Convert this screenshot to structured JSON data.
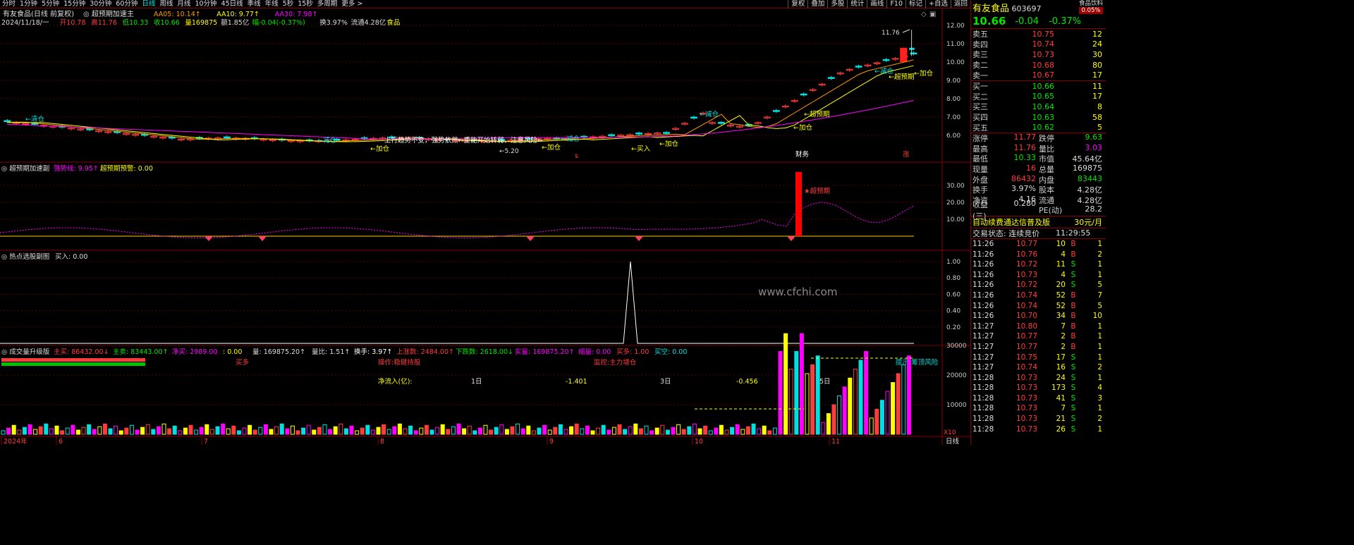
{
  "toolbar": {
    "tabs": [
      "分时",
      "1分钟",
      "5分钟",
      "15分钟",
      "30分钟",
      "60分钟",
      "日线",
      "周线",
      "月线",
      "10分钟",
      "45日线",
      "季线",
      "年线",
      "5秒",
      "15秒",
      "多周期",
      "更多 >"
    ],
    "selected": "日线",
    "right": [
      "复权",
      "叠加",
      "多股",
      "统计",
      "画线",
      "F10",
      "标记",
      "+自选",
      "返回"
    ]
  },
  "main": {
    "title": "有友食品(日线 前复权)",
    "indicator": "超预期加速主",
    "ma": [
      {
        "label": "AA05: 10.14↑",
        "color": "#ff9900"
      },
      {
        "label": "AA10: 9.77↑",
        "color": "#ffff00"
      },
      {
        "label": "AA30: 7.98↑",
        "color": "#ff00ff"
      }
    ],
    "info": [
      {
        "t": "2024/11/18/一",
        "c": "#dddddd"
      },
      {
        "t": "开10.78",
        "c": "#ff3c3c"
      },
      {
        "t": "高11.76",
        "c": "#ff3c3c"
      },
      {
        "t": "低10.33",
        "c": "#00e600"
      },
      {
        "t": "收10.66",
        "c": "#00e600"
      },
      {
        "t": "量169875",
        "c": "#ffff00"
      },
      {
        "t": "额1.85亿",
        "c": "#dddddd"
      },
      {
        "t": "幅-0.04(-0.37%)",
        "c": "#00e600"
      },
      {
        "t": "换3.97%",
        "c": "#dddddd"
      },
      {
        "t": "流通4.28亿",
        "c": "#dddddd"
      },
      {
        "t": "食品",
        "c": "#ffff00"
      }
    ],
    "yticks": [
      "12.00",
      "11.00",
      "10.00",
      "9.00",
      "8.00",
      "7.00",
      "6.00"
    ],
    "high_label": "11.76",
    "low_label": "←5.20",
    "annotations": [
      {
        "t": "←清仓",
        "c": "#00e0e0"
      },
      {
        "t": "←减仓",
        "c": "#00e0e0"
      },
      {
        "t": "←加仓",
        "c": "#ffff00"
      },
      {
        "t": "上行趋势不变，强势依然←重能开始转弱，注意风险←",
        "c": "#ffffff"
      },
      {
        "t": "←加仓",
        "c": "#ffff00"
      },
      {
        "t": "←减仓",
        "c": "#00e0e0"
      },
      {
        "t": "←买入",
        "c": "#ffff00"
      },
      {
        "t": "←加仓",
        "c": "#ffff00"
      },
      {
        "t": "←减仓",
        "c": "#00e0e0"
      },
      {
        "t": "←超预期",
        "c": "#ffff00"
      },
      {
        "t": "←加仓",
        "c": "#ffff00"
      },
      {
        "t": "←减仓",
        "c": "#00e0e0"
      },
      {
        "t": "←超预期",
        "c": "#ffff00"
      },
      {
        "t": "←加仓",
        "c": "#ffff00"
      },
      {
        "t": "财务",
        "c": "#ffffff"
      },
      {
        "t": "涨",
        "c": "#ff3c3c"
      },
      {
        "t": "s",
        "c": "#ff3c3c"
      }
    ]
  },
  "sub1": {
    "title": "超预期加速副",
    "lines": [
      {
        "label": "强势线: 9.95↑",
        "color": "#ff00ff"
      },
      {
        "label": "超预期预警: 0.00",
        "color": "#ffff00"
      }
    ],
    "yticks": [
      "30.00",
      "20.00",
      "10.00"
    ],
    "annotation": "★超预期"
  },
  "sub2": {
    "title": "热点选股副图",
    "value": "买入: 0.00",
    "yticks": [
      "1.00",
      "0.80",
      "0.60",
      "0.40",
      "0.20"
    ],
    "watermark": "www.cfchi.com"
  },
  "sub3": {
    "title": "成交量升级版",
    "items": [
      {
        "t": "主买: 86432.00↓",
        "c": "#ff3c3c"
      },
      {
        "t": "主卖: 83443.00↑",
        "c": "#00e600"
      },
      {
        "t": "净买: 2989.00",
        "c": "#ff00ff"
      },
      {
        "t": ": 0.00",
        "c": "#ffff00"
      },
      {
        "t": "量: 169875.20↑",
        "c": "#dddddd"
      },
      {
        "t": "量比: 1.51↑",
        "c": "#dddddd"
      },
      {
        "t": "换手: 3.97↑",
        "c": "#ffffff"
      },
      {
        "t": "上涨数: 2484.00↑",
        "c": "#ff3c3c"
      },
      {
        "t": "下跌数: 2618.00↓",
        "c": "#00e600"
      },
      {
        "t": "实量: 169875.20↑",
        "c": "#ff00ff"
      },
      {
        "t": "缩量: 0.00",
        "c": "#ff00ff"
      },
      {
        "t": "买多: 1.00",
        "c": "#ff3c3c"
      },
      {
        "t": "买空: 0.00",
        "c": "#00e0e0"
      }
    ],
    "labels": {
      "buy": "买多",
      "op": "操作:稳健持股",
      "mon": "监控:主力增仓",
      "tip": "提示:筹顶风险",
      "netflow": "净流入(亿):",
      "d1": "1日",
      "v1": "-1.401",
      "d3": "3日",
      "v3": "-0.456",
      "d5": "5日"
    },
    "yticks": [
      "30000",
      "20000",
      "10000"
    ],
    "scale": "X10"
  },
  "xaxis": {
    "labels": [
      "2024年",
      "6",
      "7",
      "8",
      "9",
      "10",
      "11"
    ],
    "period": "日线"
  },
  "side": {
    "name": "有友食品",
    "code": "603697",
    "badge": "食品饮料",
    "badge_pct": "0.05%",
    "price": "10.66",
    "change": "-0.04",
    "pct": "-0.37%",
    "asks": [
      {
        "l": "卖五",
        "p": "10.75",
        "v": "12"
      },
      {
        "l": "卖四",
        "p": "10.74",
        "v": "24"
      },
      {
        "l": "卖三",
        "p": "10.73",
        "v": "30"
      },
      {
        "l": "卖二",
        "p": "10.68",
        "v": "80"
      },
      {
        "l": "卖一",
        "p": "10.67",
        "v": "17"
      }
    ],
    "bids": [
      {
        "l": "买一",
        "p": "10.66",
        "v": "11"
      },
      {
        "l": "买二",
        "p": "10.65",
        "v": "17"
      },
      {
        "l": "买三",
        "p": "10.64",
        "v": "8"
      },
      {
        "l": "买四",
        "p": "10.63",
        "v": "58"
      },
      {
        "l": "买五",
        "p": "10.62",
        "v": "5"
      }
    ],
    "quote": [
      [
        {
          "l": "涨停",
          "v": "11.77",
          "c": "#ff3c3c"
        },
        {
          "l": "跌停",
          "v": "9.63",
          "c": "#00e600"
        }
      ],
      [
        {
          "l": "最高",
          "v": "11.76",
          "c": "#ff3c3c"
        },
        {
          "l": "量比",
          "v": "3.03",
          "c": "#ff00ff"
        }
      ],
      [
        {
          "l": "最低",
          "v": "10.33",
          "c": "#00e600"
        },
        {
          "l": "市值",
          "v": "45.64亿",
          "c": "#dddddd"
        }
      ],
      [
        {
          "l": "现量",
          "v": "16",
          "c": "#ff3c3c"
        },
        {
          "l": "总量",
          "v": "169875",
          "c": "#dddddd"
        }
      ],
      [
        {
          "l": "外盘",
          "v": "86432",
          "c": "#ff3c3c"
        },
        {
          "l": "内盘",
          "v": "83443",
          "c": "#00e600"
        }
      ],
      [
        {
          "l": "换手",
          "v": "3.97%",
          "c": "#dddddd"
        },
        {
          "l": "股本",
          "v": "4.28亿",
          "c": "#dddddd"
        }
      ],
      [
        {
          "l": "净资",
          "v": "4.16",
          "c": "#dddddd"
        },
        {
          "l": "流通",
          "v": "4.28亿",
          "c": "#dddddd"
        }
      ],
      [
        {
          "l": "收益(三)",
          "v": "0.280",
          "c": "#dddddd"
        },
        {
          "l": "PE(动)",
          "v": "28.2",
          "c": "#dddddd"
        }
      ]
    ],
    "promo": "自动续费通达信普及版",
    "promo_price": "30元/月",
    "status_label": "交易状态: 连续竞价",
    "status_time": "11:29:55",
    "ticks": [
      [
        "11:26",
        "10.77",
        "10",
        "B",
        "1"
      ],
      [
        "11:26",
        "10.76",
        "4",
        "B",
        "2"
      ],
      [
        "11:26",
        "10.72",
        "11",
        "S",
        "1"
      ],
      [
        "11:26",
        "10.73",
        "4",
        "S",
        "1"
      ],
      [
        "11:26",
        "10.72",
        "20",
        "S",
        "5"
      ],
      [
        "11:26",
        "10.74",
        "52",
        "B",
        "7"
      ],
      [
        "11:26",
        "10.74",
        "52",
        "B",
        "5"
      ],
      [
        "11:26",
        "10.70",
        "34",
        "B",
        "10"
      ],
      [
        "11:27",
        "10.80",
        "7",
        "B",
        "1"
      ],
      [
        "11:27",
        "10.77",
        "2",
        "B",
        "1"
      ],
      [
        "11:27",
        "10.77",
        "2",
        "B",
        "1"
      ],
      [
        "11:27",
        "10.75",
        "17",
        "S",
        "1"
      ],
      [
        "11:27",
        "10.74",
        "16",
        "S",
        "2"
      ],
      [
        "11:28",
        "10.73",
        "24",
        "S",
        "1"
      ],
      [
        "11:28",
        "10.73",
        "173",
        "S",
        "4"
      ],
      [
        "11:28",
        "10.73",
        "41",
        "S",
        "3"
      ],
      [
        "11:28",
        "10.73",
        "7",
        "S",
        "1"
      ],
      [
        "11:28",
        "10.73",
        "21",
        "S",
        "2"
      ],
      [
        "11:28",
        "10.73",
        "26",
        "S",
        "1"
      ]
    ]
  }
}
